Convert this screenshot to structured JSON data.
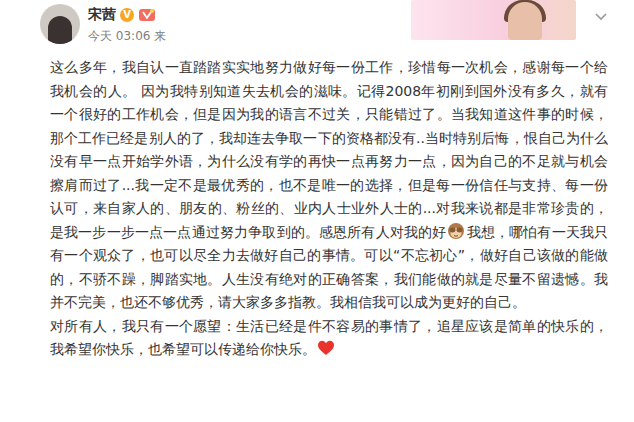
{
  "author": {
    "name": "宋茜",
    "verified_badge": "V",
    "time": "今天 03:06 来"
  },
  "body": {
    "paragraphs": [
      {
        "segments": [
          "这么多年，我自认一直踏踏实实地努力做好每一份工作，珍惜每一次机会，感谢每一个给我机会的人。 因为我特别知道失去机会的滋味。记得2008年初刚到国外没有多久，就有一个很好的工作机会，但是因为我的语言不过关，只能错过了。当我知道这件事的时候，那个工作已经是别人的了，我却连去争取一下的资格都没有..当时特别后悔，恨自己为什么没有早一点开始学外语，为什么没有学的再快一点再努力一点，因为自己的不足就与机会擦肩而过了...我一定不是最优秀的，也不是唯一的选择，但是每一份信任与支持、每一份认可，来自家人的、朋友的、粉丝的、业内人士业外人士的...对我来说都是非常珍贵的，是我一步一步一点一点通过努力争取到的。感恩所有人对我的好",
          "我想，哪怕有一天我只有一个观众了，也可以尽全力去做好自己的事情。可以“不忘初心”，做好自己该做的能做的，不骄不躁，脚踏实地。人生没有绝对的正确答案，我们能做的就是尽量不留遗憾。我并不完美，也还不够优秀，请大家多多指教。我相信我可以成为更好的自己。"
        ],
        "ends_with_heart": false
      },
      {
        "segments": [
          "对所有人，我只有一个愿望：生活已经是件不容易的事情了，追星应该是简单的快乐的，我希望你快乐，也希望可以传递给你快乐。"
        ],
        "ends_with_heart": true
      }
    ]
  }
}
